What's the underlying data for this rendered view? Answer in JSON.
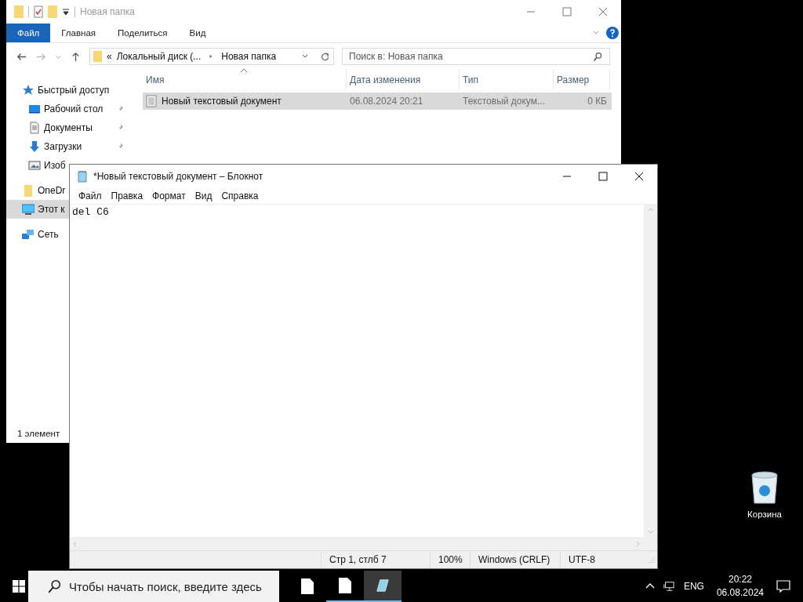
{
  "explorer": {
    "title": "Новая папка",
    "ribbon_tabs": [
      {
        "label": "Файл",
        "selected": true
      },
      {
        "label": "Главная",
        "selected": false
      },
      {
        "label": "Поделиться",
        "selected": false
      },
      {
        "label": "Вид",
        "selected": false
      }
    ],
    "address": {
      "overflow": "«",
      "crumbs": [
        "Локальный диск (...",
        "Новая папка"
      ]
    },
    "search": {
      "placeholder": "Поиск в: Новая папка"
    },
    "sidebar": [
      {
        "label": "Быстрый доступ",
        "kind": "star",
        "selected": false,
        "children": [
          {
            "label": "Рабочий стол",
            "kind": "desktop",
            "pinned": true,
            "selected": false
          },
          {
            "label": "Документы",
            "kind": "documents",
            "pinned": true,
            "selected": false
          },
          {
            "label": "Загрузки",
            "kind": "downloads",
            "pinned": true,
            "selected": false
          },
          {
            "label": "Изоб",
            "kind": "pictures",
            "pinned": false,
            "selected": false
          }
        ]
      },
      {
        "label": "OneDr",
        "kind": "folder",
        "selected": false
      },
      {
        "label": "Этот к",
        "kind": "computer",
        "selected": true
      },
      {
        "label": "Сеть",
        "kind": "network",
        "selected": false
      }
    ],
    "columns": [
      "Имя",
      "Дата изменения",
      "Тип",
      "Размер"
    ],
    "rows": [
      {
        "name": "Новый текстовый документ",
        "date": "06.08.2024 20:21",
        "type": "Текстовый докум...",
        "size": "0 КБ",
        "selected": true
      }
    ],
    "status": "1 элемент"
  },
  "notepad": {
    "title": "*Новый текстовый документ – Блокнот",
    "menu": [
      "Файл",
      "Правка",
      "Формат",
      "Вид",
      "Справка"
    ],
    "text": "del C6",
    "status": [
      "Стр 1, стлб 7",
      "100%",
      "Windows (CRLF)",
      "UTF-8"
    ]
  },
  "desktop_icons": [
    {
      "label": "Корзина"
    }
  ],
  "taskbar": {
    "search": {
      "placeholder": "Чтобы начать поиск, введите здесь"
    },
    "apps": [
      {
        "kind": "document",
        "running": false,
        "active": false
      },
      {
        "kind": "document",
        "running": true,
        "active": false
      },
      {
        "kind": "notepad",
        "running": true,
        "active": true
      }
    ],
    "language": "ENG",
    "time": "20:22",
    "date": "06.08.2024"
  }
}
